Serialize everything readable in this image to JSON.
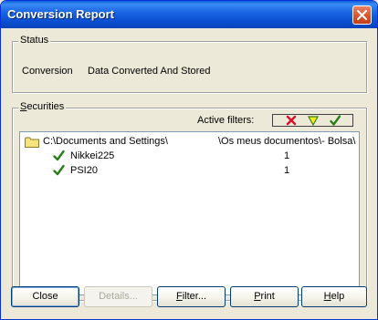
{
  "window": {
    "title": "Conversion Report"
  },
  "status": {
    "group_label": "Status",
    "key": "Conversion",
    "value": "Data Converted And Stored"
  },
  "securities": {
    "group_label_ul": "S",
    "group_label_rest": "ecurities",
    "filters_label": "Active filters:",
    "filter_icons": [
      "red-x-icon",
      "yellow-triangle-icon",
      "green-check-icon"
    ],
    "folder": {
      "path": "C:\\Documents and Settings\\",
      "path_right": "\\Os meus documentos\\- Bolsa\\"
    },
    "items": [
      {
        "name": "Nikkei225",
        "count": "1"
      },
      {
        "name": "PSI20",
        "count": "1"
      }
    ]
  },
  "buttons": {
    "close": "Close",
    "details": "Details...",
    "filter_ul": "F",
    "filter_rest": "ilter...",
    "print_ul": "P",
    "print_rest": "rint",
    "help_ul": "H",
    "help_rest": "elp"
  },
  "colors": {
    "titlebar": "#0a4fd0",
    "check": "#2e7d1a",
    "x": "#d8102b",
    "triangle": "#e8e800"
  }
}
